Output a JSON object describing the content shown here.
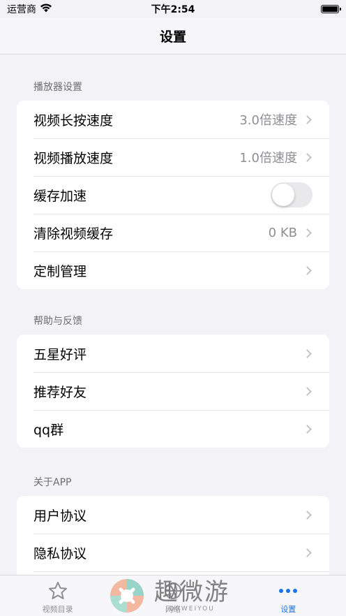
{
  "status_bar": {
    "carrier": "运营商",
    "time": "下午2:54"
  },
  "nav": {
    "title": "设置"
  },
  "sections": [
    {
      "header": "播放器设置",
      "rows": [
        {
          "label": "视频长按速度",
          "value": "3.0倍速度",
          "type": "chevron"
        },
        {
          "label": "视频播放速度",
          "value": "1.0倍速度",
          "type": "chevron"
        },
        {
          "label": "缓存加速",
          "type": "toggle",
          "on": false
        },
        {
          "label": "清除视频缓存",
          "value": "0 KB",
          "type": "chevron"
        },
        {
          "label": "定制管理",
          "type": "chevron"
        }
      ]
    },
    {
      "header": "帮助与反馈",
      "rows": [
        {
          "label": "五星好评",
          "type": "chevron"
        },
        {
          "label": "推荐好友",
          "type": "chevron"
        },
        {
          "label": "qq群",
          "type": "chevron"
        }
      ]
    },
    {
      "header": "关于APP",
      "rows": [
        {
          "label": "用户协议",
          "type": "chevron"
        },
        {
          "label": "隐私协议",
          "type": "chevron"
        }
      ]
    }
  ],
  "tabs": [
    {
      "label": "视频目录",
      "icon": "star-icon",
      "active": false
    },
    {
      "label": "网络",
      "icon": "globe-icon",
      "active": false
    },
    {
      "label": "设置",
      "icon": "more-dots-icon",
      "active": true
    }
  ],
  "watermark": {
    "text_cn": "趣微游",
    "text_en": "QUWEIYOU"
  },
  "colors": {
    "accent": "#1a73e8",
    "background": "#f2f2f7",
    "secondary_text": "#8e8e93"
  }
}
